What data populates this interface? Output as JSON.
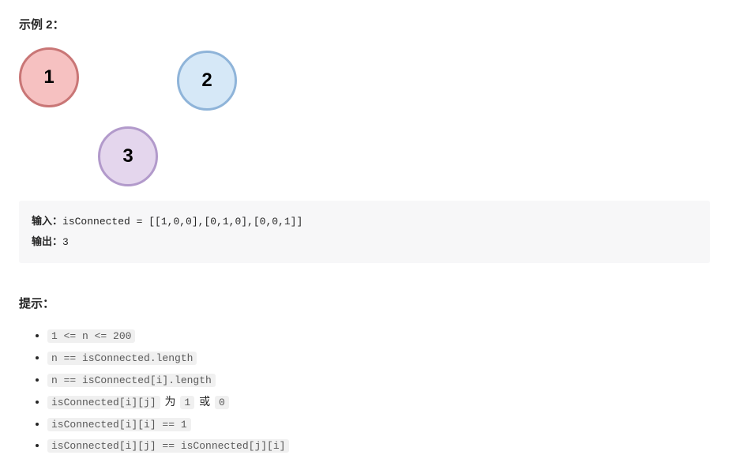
{
  "example": {
    "title": "示例 2：",
    "nodes": {
      "n1": "1",
      "n2": "2",
      "n3": "3"
    },
    "inputLabel": "输入：",
    "inputText": "isConnected = [[1,0,0],[0,1,0],[0,0,1]]",
    "outputLabel": "输出：",
    "outputText": "3"
  },
  "hints": {
    "title": "提示：",
    "items": [
      {
        "parts": [
          {
            "t": "code",
            "v": "1 <= n <= 200"
          }
        ]
      },
      {
        "parts": [
          {
            "t": "code",
            "v": "n == isConnected.length"
          }
        ]
      },
      {
        "parts": [
          {
            "t": "code",
            "v": "n == isConnected[i].length"
          }
        ]
      },
      {
        "parts": [
          {
            "t": "code",
            "v": "isConnected[i][j]"
          },
          {
            "t": "text",
            "v": " 为 "
          },
          {
            "t": "code",
            "v": "1"
          },
          {
            "t": "text",
            "v": " 或 "
          },
          {
            "t": "code",
            "v": "0"
          }
        ]
      },
      {
        "parts": [
          {
            "t": "code",
            "v": "isConnected[i][i] == 1"
          }
        ]
      },
      {
        "parts": [
          {
            "t": "code",
            "v": "isConnected[i][j] == isConnected[j][i]"
          }
        ]
      }
    ]
  }
}
